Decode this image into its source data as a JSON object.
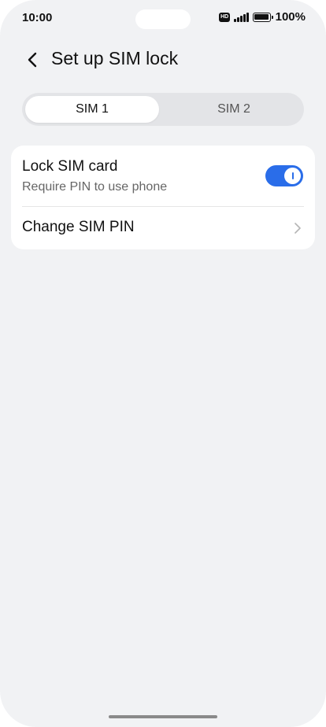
{
  "status_bar": {
    "time": "10:00",
    "hd_badge": "HD",
    "battery_percent": "100%"
  },
  "header": {
    "title": "Set up SIM lock",
    "back_icon": "chevron-left-icon"
  },
  "sim_tabs": [
    {
      "label": "SIM 1",
      "selected": true
    },
    {
      "label": "SIM 2",
      "selected": false
    }
  ],
  "settings": {
    "lock_sim": {
      "title": "Lock SIM card",
      "subtitle": "Require PIN to use phone",
      "enabled": true
    },
    "change_pin": {
      "title": "Change SIM PIN",
      "icon": "chevron-right-icon"
    }
  },
  "colors": {
    "accent": "#2a6de9",
    "background": "#f1f2f4",
    "card": "#ffffff"
  }
}
